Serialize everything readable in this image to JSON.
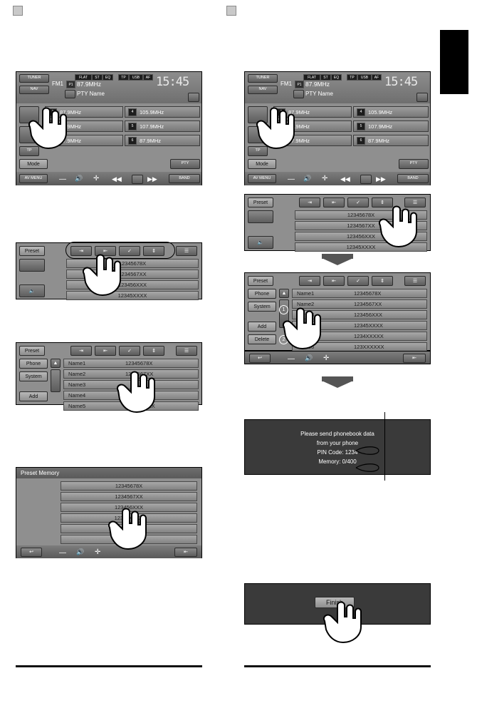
{
  "page": {
    "corner_marks": [
      "top-left-mark",
      "top-right-mark"
    ],
    "black_tab": "chapter-thumb-index"
  },
  "screens": {
    "tuner_left": {
      "source_label": "TUNER",
      "nav_label": "NAV",
      "status_flags": [
        "FLAT",
        "ST",
        "EQ",
        "TP",
        "USB",
        "AF"
      ],
      "band": "FM1",
      "preset_number": "P1",
      "frequency": "87.9MHz",
      "pty_label": "PTY Name",
      "clock": "15:45",
      "presets": [
        {
          "no": "1",
          "freq": "87.9MHz"
        },
        {
          "no": "4",
          "freq": "105.9MHz"
        },
        {
          "no": "2",
          "freq": "89.9MHz"
        },
        {
          "no": "5",
          "freq": "107.9MHz"
        },
        {
          "no": "3",
          "freq": "97.9MHz"
        },
        {
          "no": "6",
          "freq": "87.9MHz"
        }
      ],
      "mode_button": "Mode",
      "tp_button": "TP",
      "pty_button": "PTY",
      "avmenu_button": "AV MENU",
      "band_button": "BAND"
    },
    "tuner_right": {
      "source_label": "TUNER",
      "nav_label": "NAV",
      "status_flags": [
        "FLAT",
        "ST",
        "EQ",
        "TP",
        "USB",
        "AF"
      ],
      "band": "FM1",
      "preset_number": "P1",
      "frequency": "87.9MHz",
      "pty_label": "PTY Name",
      "clock": "15:45",
      "presets": [
        {
          "no": "1",
          "freq": "87.9MHz"
        },
        {
          "no": "4",
          "freq": "105.9MHz"
        },
        {
          "no": "2",
          "freq": "89.9MHz"
        },
        {
          "no": "5",
          "freq": "107.9MHz"
        },
        {
          "no": "3",
          "freq": "97.9MHz"
        },
        {
          "no": "6",
          "freq": "87.9MHz"
        }
      ],
      "mode_button": "Mode",
      "tp_button": "TP",
      "pty_button": "PTY",
      "avmenu_button": "AV MENU",
      "band_button": "BAND"
    },
    "preset_left": {
      "preset_tab": "Preset",
      "list": [
        "12345678X",
        "1234567XX",
        "123456XXX",
        "12345XXXX"
      ]
    },
    "preset_right": {
      "preset_tab": "Preset",
      "list": [
        "12345678X",
        "1234567XX",
        "123456XXX",
        "12345XXXX"
      ]
    },
    "phonebook_left": {
      "preset_tab": "Preset",
      "phone_button": "Phone",
      "system_button": "System",
      "add_button": "Add",
      "rows": [
        {
          "name": "Name1",
          "number": "12345678X"
        },
        {
          "name": "Name2",
          "number": "1234567XX"
        },
        {
          "name": "Name3",
          "number": ""
        },
        {
          "name": "Name4",
          "number": "12345XXXX"
        },
        {
          "name": "Name5",
          "number": "1234XXXXX"
        }
      ]
    },
    "phonebook_right": {
      "preset_tab": "Preset",
      "phone_button": "Phone",
      "system_button": "System",
      "add_button": "Add",
      "delete_button": "Delete",
      "step_1": "1",
      "step_2": "2",
      "rows": [
        {
          "name": "Name1",
          "number": "12345678X"
        },
        {
          "name": "Name2",
          "number": "1234567XX"
        },
        {
          "name": "Name3",
          "number": "123456XXX"
        },
        {
          "name": "Name4",
          "number": "12345XXXX"
        },
        {
          "name": "Name5",
          "number": "1234XXXXX"
        },
        {
          "name": "Name6",
          "number": "123XXXXXX"
        }
      ]
    },
    "preset_memory": {
      "title": "Preset Memory",
      "list": [
        "12345678X",
        "1234567XX",
        "123456XXX",
        "12345XXXX",
        "1234XXXXX",
        "123XXXXXX"
      ]
    },
    "message_dialog": {
      "line1": "Please send phonebook data",
      "line2": "from your phone",
      "line3": "PIN Code: 1234",
      "line4": "Memory: 0/400"
    },
    "finish_dialog": {
      "finish_button": "Finish"
    }
  }
}
